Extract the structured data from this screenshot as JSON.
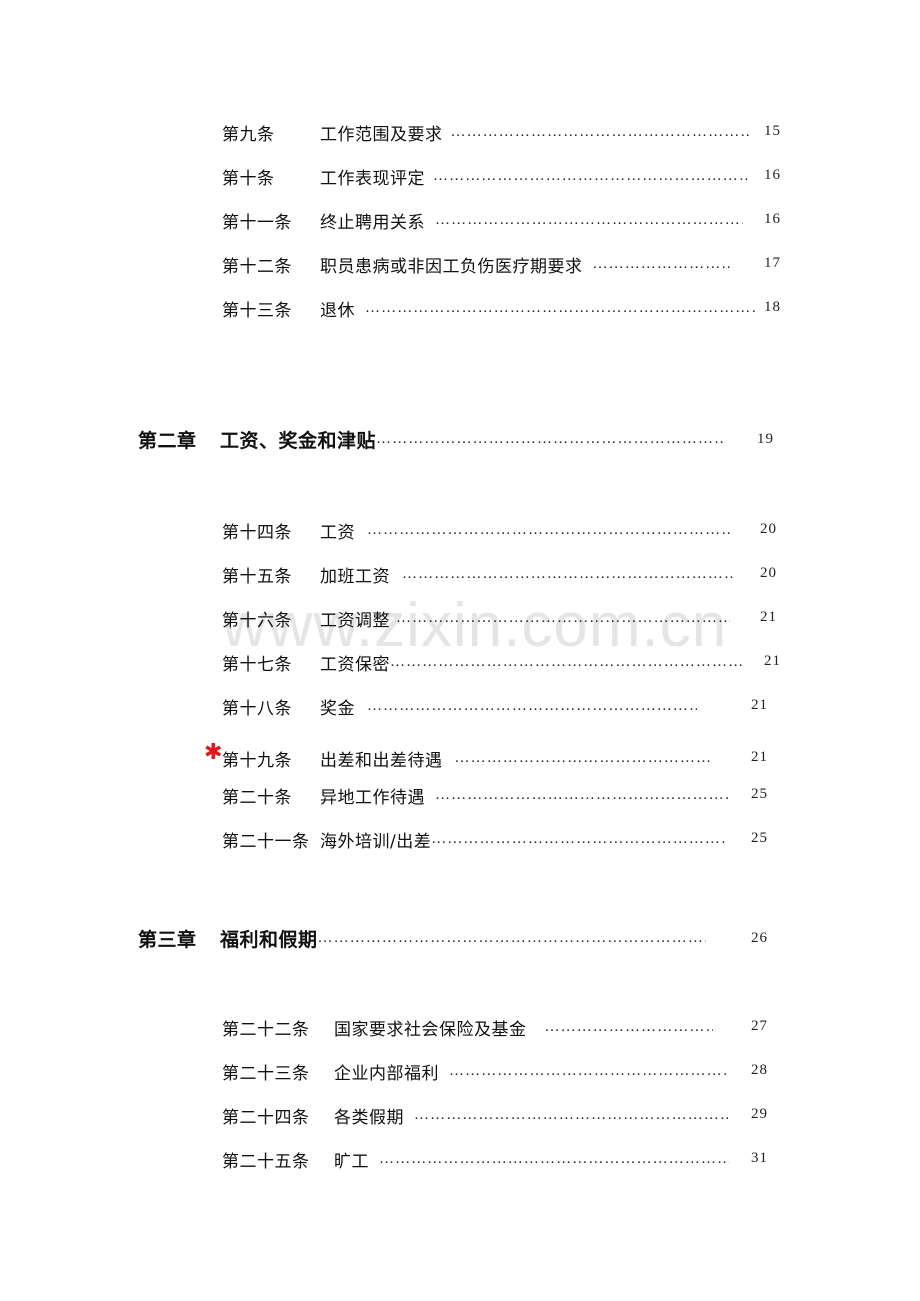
{
  "watermark": "www.zixin.com.cn",
  "accent_colors": {
    "star": "#e8131a"
  },
  "toc": {
    "section1_articles": [
      {
        "num": "第九条",
        "title": "工作范围及要求",
        "page": "15"
      },
      {
        "num": "第十条",
        "title": "工作表现评定",
        "page": "16"
      },
      {
        "num": "第十一条",
        "title": "终止聘用关系",
        "page": "16"
      },
      {
        "num": "第十二条",
        "title": "职员患病或非因工负伤医疗期要求",
        "page": "17"
      },
      {
        "num": "第十三条",
        "title": "退休",
        "page": "18"
      }
    ],
    "chapter2": {
      "num": "第二章",
      "title": "工资、奖金和津贴",
      "page": "19"
    },
    "chapter2_articles": [
      {
        "num": "第十四条",
        "title": "工资",
        "page": "20"
      },
      {
        "num": "第十五条",
        "title": "加班工资",
        "page": "20"
      },
      {
        "num": "第十六条",
        "title": "工资调整",
        "page": "21"
      },
      {
        "num": "第十七条",
        "title": "工资保密",
        "page": "21"
      },
      {
        "num": "第十八条",
        "title": "奖金",
        "page": "21"
      },
      {
        "num": "第十九条",
        "title": "出差和出差待遇",
        "page": "21",
        "marker": "✱"
      },
      {
        "num": "第二十条",
        "title": "异地工作待遇",
        "page": "25"
      },
      {
        "num": "第二十一条",
        "title": "海外培训/出差",
        "page": "25"
      }
    ],
    "chapter3": {
      "num": "第三章",
      "title": "福利和假期",
      "page": "26"
    },
    "chapter3_articles": [
      {
        "num": "第二十二条",
        "title": "国家要求社会保险及基金",
        "page": "27"
      },
      {
        "num": "第二十三条",
        "title": "企业内部福利",
        "page": "28"
      },
      {
        "num": "第二十四条",
        "title": "各类假期",
        "page": "29"
      },
      {
        "num": "第二十五条",
        "title": "旷工",
        "page": "31"
      }
    ],
    "leader_dots": "……………………………………………………………………………………………………"
  }
}
